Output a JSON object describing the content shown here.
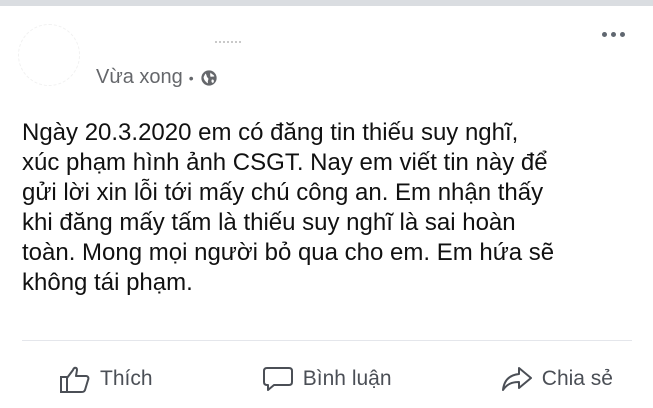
{
  "post": {
    "timestamp": "Vừa xong",
    "separator": "•",
    "privacy_icon": "globe-icon",
    "more_icon": "more-options-icon",
    "text": "Ngày 20.3.2020 em có đăng tin thiếu suy nghĩ,\nxúc phạm hình ảnh CSGT. Nay em viết tin này để\ngửi lời xin lỗi tới mấy chú công an. Em nhận thấy\nkhi đăng mấy tấm  là thiếu suy nghĩ là sai hoàn\ntoàn. Mong mọi người bỏ qua cho em. Em hứa sẽ\nkhông tái phạm."
  },
  "actions": {
    "like": {
      "label": "Thích",
      "icon": "thumbs-up-icon"
    },
    "comment": {
      "label": "Bình luận",
      "icon": "comment-icon"
    },
    "share": {
      "label": "Chia sẻ",
      "icon": "share-icon"
    }
  },
  "colors": {
    "text": "#111111",
    "meta": "#65676b",
    "action": "#4b4f56",
    "divider": "#e4e6eb"
  }
}
